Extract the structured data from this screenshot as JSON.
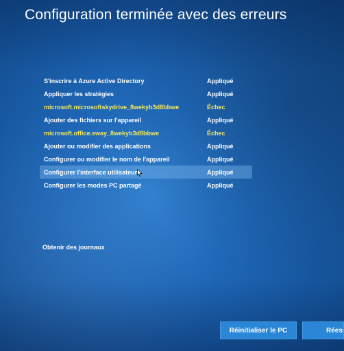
{
  "window": {
    "title": "Configuration terminée avec des erreurs"
  },
  "status_list": [
    {
      "name": "S'inscrire à Azure Active Directory",
      "result": "Appliqué",
      "state": "ok"
    },
    {
      "name": "Appliquer les stratégies",
      "result": "Appliqué",
      "state": "ok"
    },
    {
      "name": "microsoft.microsoftskydrive_8wekyb3d8bbwe",
      "result": "Échec",
      "state": "failed"
    },
    {
      "name": "Ajouter des fichiers sur l'appareil",
      "result": "Appliqué",
      "state": "ok"
    },
    {
      "name": "microsoft.office.sway_8wekyb3d8bbwe",
      "result": "Échec",
      "state": "failed"
    },
    {
      "name": "Ajouter ou modifier des applications",
      "result": "Appliqué",
      "state": "ok"
    },
    {
      "name": "Configurer ou modifier le nom de l'appareil",
      "result": "Appliqué",
      "state": "ok"
    },
    {
      "name": "Configurer l'interface utilisateur",
      "result": "Appliqué",
      "state": "ok",
      "highlighted": true
    },
    {
      "name": "Configurer les modes PC partagé",
      "result": "Appliqué",
      "state": "ok"
    }
  ],
  "links": {
    "get_logs": "Obtenir des journaux"
  },
  "buttons": {
    "reset_pc": "Réinitialiser le PC",
    "retry": "Réessa"
  },
  "colors": {
    "background": "#1f68b8",
    "failed_text": "#f4e85a",
    "button": "#2a86d6",
    "highlight": "#78b4eb"
  },
  "icons": {
    "cursor": "mouse-pointer-icon"
  }
}
